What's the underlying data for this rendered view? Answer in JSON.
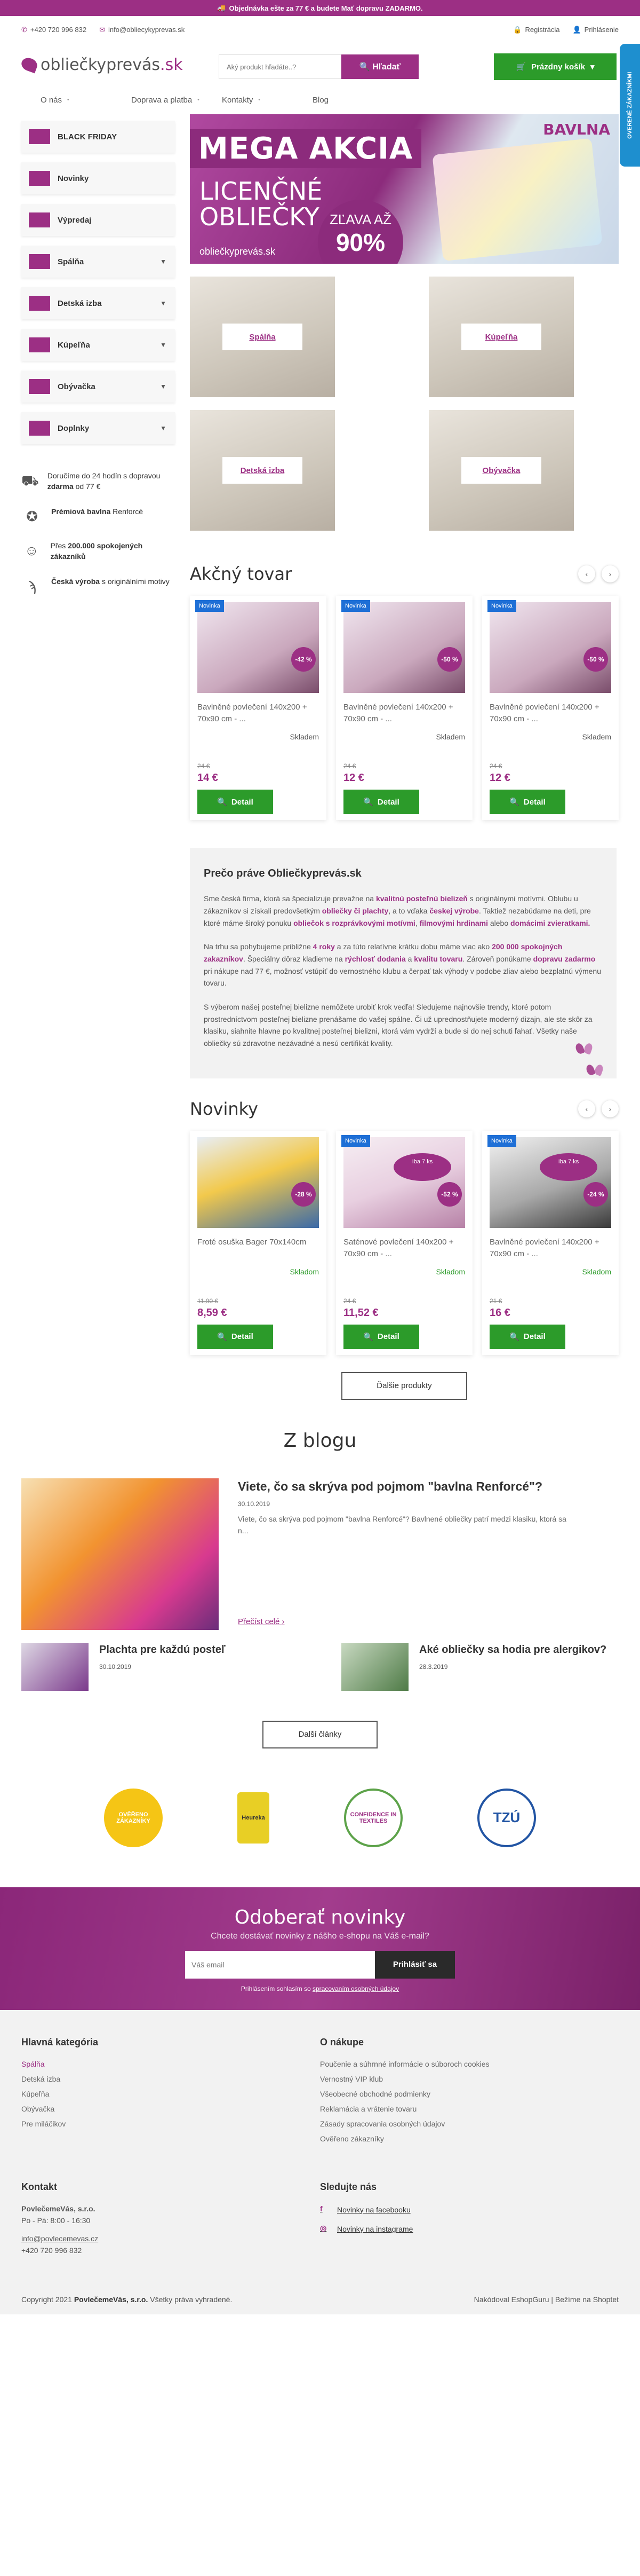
{
  "topbar": {
    "promo": "Objednávka ešte za 77 € a budete Mať dopravu ZADARMO."
  },
  "contact_bar": {
    "phone": "+420 720 996 832",
    "email": "info@obliecykyprevas.sk",
    "register": "Registrácia",
    "login": "Prihlásenie"
  },
  "header": {
    "logo_text": "obliečkyprevás",
    "logo_tld": ".sk",
    "search_placeholder": "Aký produkt hľadáte..?",
    "search_button": "Hľadať",
    "cart_label": "Prázdny košík",
    "side_badge": "OVERENÉ ZÁKAZNÍKMI"
  },
  "nav": [
    "O nás",
    "Doprava a platba",
    "Kontakty",
    "Blog"
  ],
  "categories": [
    {
      "label": "BLACK FRIDAY",
      "has_children": false
    },
    {
      "label": "Novinky",
      "has_children": false
    },
    {
      "label": "Výpredaj",
      "has_children": false
    },
    {
      "label": "Spálňa",
      "has_children": true
    },
    {
      "label": "Detská izba",
      "has_children": true
    },
    {
      "label": "Kúpeľňa",
      "has_children": true
    },
    {
      "label": "Obývačka",
      "has_children": true
    },
    {
      "label": "Doplnky",
      "has_children": true
    }
  ],
  "benefits": [
    {
      "icon": "truck-icon",
      "text_pre": "Doručíme do 24 hodín s dopravou ",
      "bold": "zdarma",
      "text_post": " od 77 €"
    },
    {
      "icon": "award-icon",
      "text_pre": "",
      "bold": "Prémiová bavlna",
      "text_post": " Renforcé"
    },
    {
      "icon": "people-icon",
      "text_pre": "Přes ",
      "bold": "200.000 spokojených zákazníků",
      "text_post": ""
    },
    {
      "icon": "fingerprint-icon",
      "text_pre": "",
      "bold": "Česká výroba",
      "text_post": " s originálními motivy"
    }
  ],
  "banner": {
    "mega": "MEGA AKCIA",
    "bavlna": "BAVLNA",
    "licencne_1": "LICENČNÉ",
    "licencne_2": "OBLIEČKY",
    "zlava_1": "ZĽAVA AŽ",
    "zlava_2": "90%",
    "url": "obliečkyprevás.sk"
  },
  "category_tiles": [
    "Spálňa",
    "Kúpeľňa",
    "Detská izba",
    "Obývačka"
  ],
  "action_section": {
    "title": "Akčný tovar",
    "products": [
      {
        "badge": "Novinka",
        "discount": "-42 %",
        "name": "Bavlněné povlečení 140x200 + 70x90 cm - ...",
        "stock": "Skladem",
        "old_price": "24 €",
        "price": "14 €",
        "button": "Detail"
      },
      {
        "badge": "Novinka",
        "discount": "-50 %",
        "name": "Bavlněné povlečení 140x200 + 70x90 cm - ...",
        "stock": "Skladem",
        "old_price": "24 €",
        "price": "12 €",
        "button": "Detail"
      },
      {
        "badge": "Novinka",
        "discount": "-50 %",
        "name": "Bavlněné povlečení 140x200 + 70x90 cm - ...",
        "stock": "Skladem",
        "old_price": "24 €",
        "price": "12 €",
        "button": "Detail"
      }
    ]
  },
  "why": {
    "title": "Prečo práve Obliečkyprevás.sk",
    "p1": [
      {
        "t": "Sme česká firma, ktorá sa špecializuje prevažne na "
      },
      {
        "b": "kvalitnú posteľnú bielizeň"
      },
      {
        "t": " s originálnymi motívmi. Oblubu u zákazníkov si získali predovšetkým "
      },
      {
        "b": "obliečky či plachty"
      },
      {
        "t": ", a to vďaka "
      },
      {
        "b": "českej výrobe"
      },
      {
        "t": ". Taktiež nezabúdame na deti, pre ktoré máme široký ponuku "
      },
      {
        "b": "obliečok s rozprávkovými motívmi"
      },
      {
        "t": ", "
      },
      {
        "b": "filmovými hrdinami"
      },
      {
        "t": " alebo "
      },
      {
        "b": "domácimi zvieratkami."
      }
    ],
    "p2": [
      {
        "t": "Na trhu sa pohybujeme približne "
      },
      {
        "b": "4 roky"
      },
      {
        "t": " a za túto relatívne krátku dobu máme viac ako "
      },
      {
        "b": "200 000 spokojných zakazníkov"
      },
      {
        "t": ". Špeciálny dôraz kladieme na "
      },
      {
        "b": "rýchlosť dodania"
      },
      {
        "t": " a "
      },
      {
        "b": "kvalitu tovaru"
      },
      {
        "t": ". Zároveň ponúkame "
      },
      {
        "b": "dopravu zadarmo"
      },
      {
        "t": " pri nákupe nad 77 €, možnosť vstúpiť do vernostného klubu a čerpať tak výhody v podobe zliav alebo bezplatnú výmenu tovaru."
      }
    ],
    "p3": [
      {
        "t": "S výberom našej posteľnej bielizne nemôžete urobiť krok vedľa! Sledujeme najnovšie trendy, ktoré potom prostredníctvom posteľnej bielizne prenášame do vašej spálne. Či už uprednostňujete moderný dizajn, ale ste skôr za klasiku, siahnite hlavne po kvalitnej posteľnej bielizni, ktorá vám vydrží a bude si do nej schuti ľahať. Všetky naše obliečky sú zdravotne nezávadné a nesú certifikát kvality."
      }
    ]
  },
  "new_section": {
    "title": "Novinky",
    "products": [
      {
        "badge": "",
        "sale": "",
        "discount": "-28 %",
        "name": "Froté osuška Bager 70x140cm",
        "stock": "Skladom",
        "old_price": "11,90 €",
        "price": "8,59 €",
        "button": "Detail"
      },
      {
        "badge": "Novinka",
        "sale": "Iba 7 ks",
        "discount": "-52 %",
        "name": "Saténové povlečení 140x200 + 70x90 cm - ...",
        "stock": "Skladom",
        "old_price": "24 €",
        "price": "11,52 €",
        "button": "Detail"
      },
      {
        "badge": "Novinka",
        "sale": "Iba 7 ks",
        "discount": "-24 %",
        "name": "Bavlněné povlečení 140x200 + 70x90 cm - ...",
        "stock": "Skladom",
        "old_price": "21 €",
        "price": "16 €",
        "button": "Detail"
      }
    ],
    "more_button": "Ďalšie produkty"
  },
  "blog": {
    "title": "Z blogu",
    "main_post": {
      "title": "Viete, čo sa skrýva pod pojmom \"bavlna Renforcé\"?",
      "date": "30.10.2019",
      "excerpt": "Viete, čo sa skrýva pod pojmom \"bavlna Renforcé\"? Bavlnené obliečky patrí medzi klasiku, ktorá sa n...",
      "read_more": "Přečíst celé"
    },
    "small_posts": [
      {
        "title": "Plachta pre každú posteľ",
        "date": "30.10.2019"
      },
      {
        "title": "Aké obliečky sa hodia pre alergikov?",
        "date": "28.3.2019"
      }
    ],
    "more_button": "Další články"
  },
  "certs": [
    "OVĚŘENO ZÁKAZNÍKY",
    "Heureka",
    "CONFIDENCE IN TEXTILES",
    "TZÚ"
  ],
  "newsletter": {
    "title": "Odoberať novinky",
    "subtitle": "Chcete dostávať novinky z nášho e-shopu na Váš e-mail?",
    "placeholder": "Váš email",
    "button": "Prihlásiť sa",
    "consent_pre": "Prihlásením sohlasím so ",
    "consent_link": "spracovaním osobných údajov"
  },
  "footer": {
    "col1_title": "Hlavná kategória",
    "col1_items": [
      "Spálňa",
      "Detská izba",
      "Kúpeľňa",
      "Obývačka",
      "Pre miláčikov"
    ],
    "col2_title": "O nákupe",
    "col2_items": [
      "Poučenie a súhrnné informácie o súboroch cookies",
      "Vernostný VIP klub",
      "Všeobecné obchodné podmienky",
      "Reklamácia a vrátenie tovaru",
      "Zásady spracovania osobných údajov",
      "Ověřeno zákazníky"
    ],
    "contact_title": "Kontakt",
    "company": "PovlečemeVás, s.r.o.",
    "hours": "Po - Pá: 8:00 - 16:30",
    "email": "info@povlecemevas.cz",
    "phone": "+420 720 996 832",
    "social_title": "Sledujte nás",
    "facebook": "Novinky na facebooku",
    "instagram": "Novinky na instagrame",
    "copyright_pre": "Copyright 2021 ",
    "copyright_company": "PovlečemeVás, s.r.o.",
    "copyright_post": " Všetky práva vyhradené.",
    "credits": "Nakódoval EshopGuru | Bežíme na Shoptet"
  }
}
